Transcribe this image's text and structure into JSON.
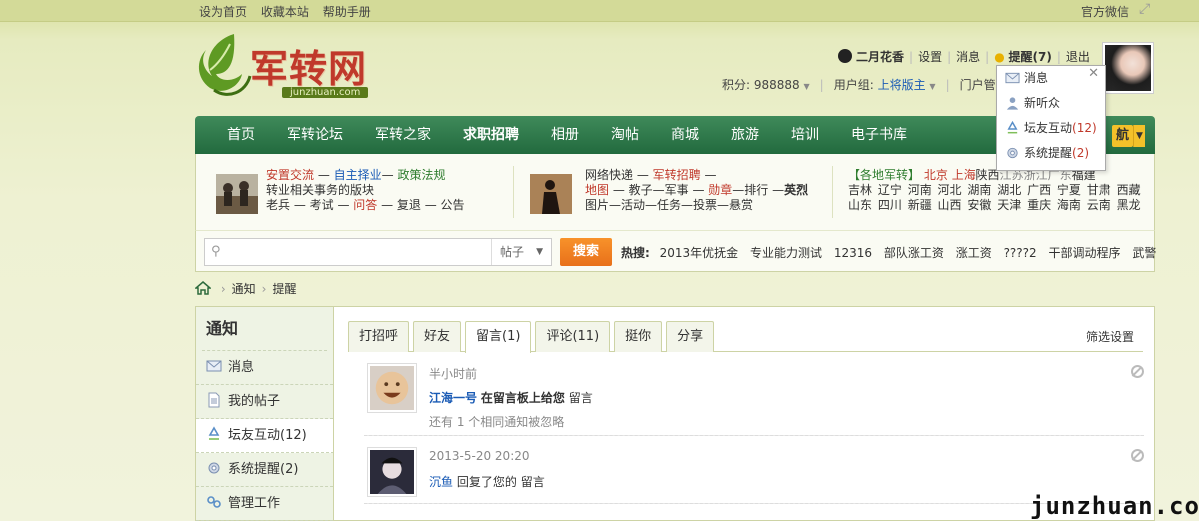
{
  "topbar": {
    "links": [
      "设为首页",
      "收藏本站",
      "帮助手册"
    ],
    "wechat": "官方微信"
  },
  "logo": {
    "brand": "军转网",
    "sub": "junzhuan.com"
  },
  "user": {
    "name": "二月花香",
    "settings": "设置",
    "messages": "消息",
    "remind": "提醒(7)",
    "logout": "退出",
    "score_label": "积分: 988888",
    "group_label": "用户组:",
    "group_value": "上将版主",
    "portal": "门户管"
  },
  "nav": {
    "items": [
      "首页",
      "军转论坛",
      "军转之家",
      "求职招聘",
      "相册",
      "淘帖",
      "商城",
      "旅游",
      "培训",
      "电子书库"
    ],
    "nav_button": "航"
  },
  "quick": {
    "col1": {
      "line1": [
        "安置交流",
        " — ",
        "自主择业",
        "— ",
        "政策法规"
      ],
      "line2": "转业相关事务的版块",
      "line3": [
        "老兵",
        " — 考试 — ",
        "问答",
        " — 复退 — 公告"
      ]
    },
    "col2": {
      "line1": [
        "网络快递",
        " — ",
        "军转招聘",
        " —"
      ],
      "line2": [
        "地图",
        " — 教子—军事 — ",
        "勋章",
        "—排行 —",
        "英烈"
      ],
      "line3": "图片—活动—任务—投票—悬赏"
    },
    "col3": {
      "line1": [
        "【各地军转】",
        "北京",
        "上海",
        "陕西",
        "江苏",
        "浙江",
        "广东",
        "福建"
      ],
      "line2": [
        "吉林",
        "辽宁",
        "河南",
        "河北",
        "湖南",
        "湖北",
        "广西",
        "宁夏",
        "甘肃",
        "西藏"
      ],
      "line3": [
        "山东",
        "四川",
        "新疆",
        "山西",
        "安徽",
        "天津",
        "重庆",
        "海南",
        "云南",
        "黑龙"
      ]
    }
  },
  "search": {
    "placeholder": "",
    "scope": "帖子",
    "button": "搜索",
    "hot_label": "热搜:",
    "hot_items": [
      "2013年优抚金",
      "专业能力测试",
      "12316",
      "部队涨工资",
      "涨工资",
      "????2",
      "干部调动程序",
      "武警"
    ]
  },
  "breadcrumb": {
    "items": [
      "通知",
      "提醒"
    ]
  },
  "sidebar": {
    "title": "通知",
    "items": [
      {
        "label": "消息"
      },
      {
        "label": "我的帖子"
      },
      {
        "label": "坛友互动(12)"
      },
      {
        "label": "系统提醒(2)"
      },
      {
        "label": "管理工作"
      }
    ]
  },
  "main": {
    "tabs": [
      "打招呼",
      "好友",
      "留言(1)",
      "评论(11)",
      "挺你",
      "分享"
    ],
    "filter": "筛选设置",
    "notices": [
      {
        "time": "半小时前",
        "user": "江海一号",
        "action": "在留言板上给您",
        "link": "留言",
        "extra": "还有 1 个相同通知被忽略"
      },
      {
        "time": "2013-5-20 20:20",
        "user": "沉鱼",
        "action": "回复了您的",
        "link": "留言",
        "extra": ""
      }
    ]
  },
  "dropdown": {
    "items": [
      {
        "label": "消息",
        "count": ""
      },
      {
        "label": "新听众",
        "count": ""
      },
      {
        "label": "坛友互动",
        "count": "(12)"
      },
      {
        "label": "系统提醒",
        "count": "(2)"
      }
    ]
  },
  "watermark": "junzhuan.com"
}
